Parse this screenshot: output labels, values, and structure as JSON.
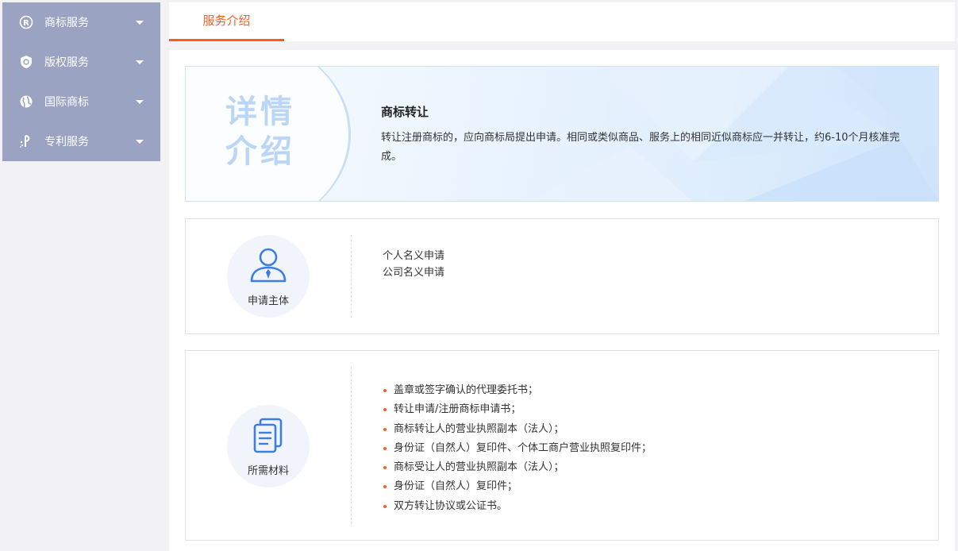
{
  "sidebar": {
    "items": [
      {
        "label": "商标服务",
        "icon": "registered-icon"
      },
      {
        "label": "版权服务",
        "icon": "shield-icon"
      },
      {
        "label": "国际商标",
        "icon": "globe-icon"
      },
      {
        "label": "专利服务",
        "icon": "patent-icon"
      }
    ]
  },
  "tabs": [
    {
      "label": "服务介绍"
    }
  ],
  "banner": {
    "art_line1": "详情",
    "art_line2": "介绍",
    "title": "商标转让",
    "description": "转让注册商标的，应向商标局提出申请。相同或类似商品、服务上的相同近似商标应一并转让，约6-10个月核准完成。"
  },
  "subject": {
    "label": "申请主体",
    "icon": "user-icon",
    "items": [
      "个人名义申请",
      "公司名义申请"
    ]
  },
  "materials": {
    "label": "所需材料",
    "icon": "documents-icon",
    "items": [
      "盖章或签字确认的代理委托书；",
      "转让申请/注册商标申请书；",
      "商标转让人的营业执照副本（法人）；",
      "身份证（自然人）复印件、个体工商户营业执照复印件；",
      "商标受让人的营业执照副本（法人）；",
      "身份证（自然人）复印件；",
      "双方转让协议或公证书。"
    ]
  },
  "colors": {
    "accent": "#ff5b23",
    "sidebar_bg": "#9aa3c2",
    "icon_blue": "#3d7ee0"
  }
}
